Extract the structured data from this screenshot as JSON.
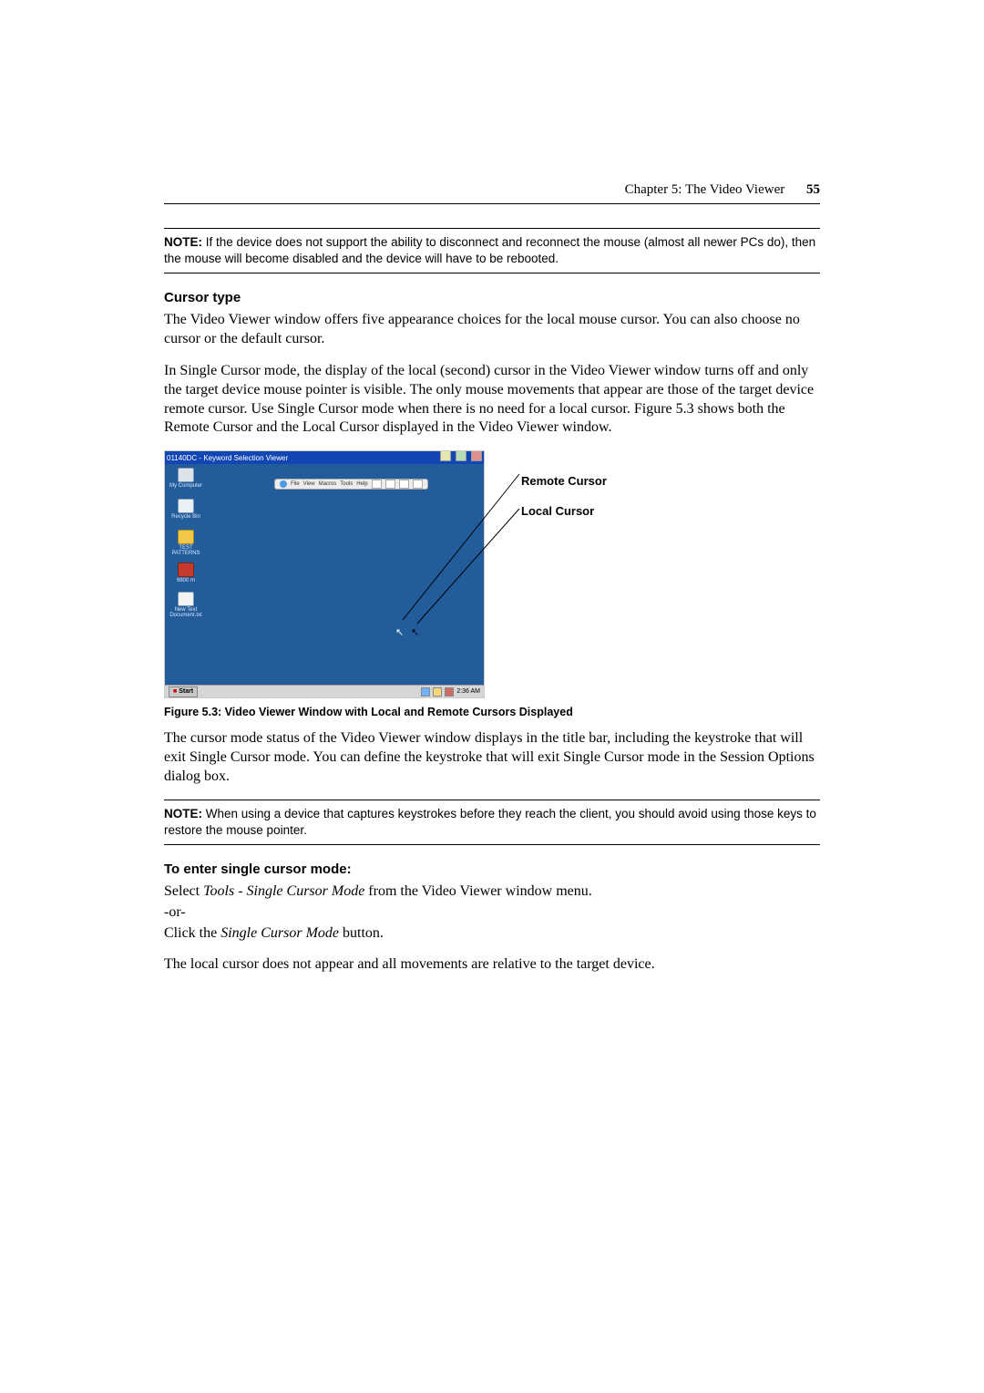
{
  "header": {
    "chapter": "Chapter 5: The Video Viewer",
    "page": "55"
  },
  "note1": {
    "label": "NOTE:",
    "text": " If the device does not support the ability to disconnect and reconnect the mouse (almost all newer PCs do), then the mouse will become disabled and the device will have to be rebooted."
  },
  "section1": {
    "heading": "Cursor type",
    "para1": "The Video Viewer window offers five appearance choices for the local mouse cursor. You can also choose no cursor or the default cursor.",
    "para2": "In Single Cursor mode, the display of the local (second) cursor in the Video Viewer window turns off and only the target device mouse pointer is visible. The only mouse movements that appear are those of the target device remote cursor. Use Single Cursor mode when there is no need for a local cursor. Figure 5.3 shows both the Remote Cursor and the Local Cursor displayed in the Video Viewer window."
  },
  "figure": {
    "title": "01140DC - Keyword Selection Viewer",
    "menus": [
      "File",
      "View",
      "Macros",
      "Tools",
      "Help"
    ],
    "icons": {
      "mycomputer": "My Computer",
      "recycle": "Recycle Bin",
      "test": "TEST PATTERNS",
      "nine": "9800 m",
      "newtext": "New Text Document.txt"
    },
    "taskbar": {
      "start": "Start",
      "clock": "2:36 AM"
    },
    "labels": {
      "remote": "Remote Cursor",
      "local": "Local Cursor"
    },
    "caption": "Figure 5.3: Video Viewer Window with Local and Remote Cursors Displayed"
  },
  "para3": "The cursor mode status of the Video Viewer window displays in the title bar, including the keystroke that will exit Single Cursor mode. You can define the keystroke that will exit Single Cursor mode in the Session Options dialog box.",
  "note2": {
    "label": "NOTE:",
    "text": " When using a device that captures keystrokes before they reach the client, you should avoid using those keys to restore the mouse pointer."
  },
  "section2": {
    "heading": "To enter single cursor mode:",
    "p1_pre": "Select ",
    "p1_em": "Tools - Single Cursor Mode",
    "p1_post": " from the Video Viewer window menu.",
    "p2": "-or-",
    "p3_pre": "Click the ",
    "p3_em": "Single Cursor Mode",
    "p3_post": " button.",
    "p4": "The local cursor does not appear and all movements are relative to the target device."
  }
}
